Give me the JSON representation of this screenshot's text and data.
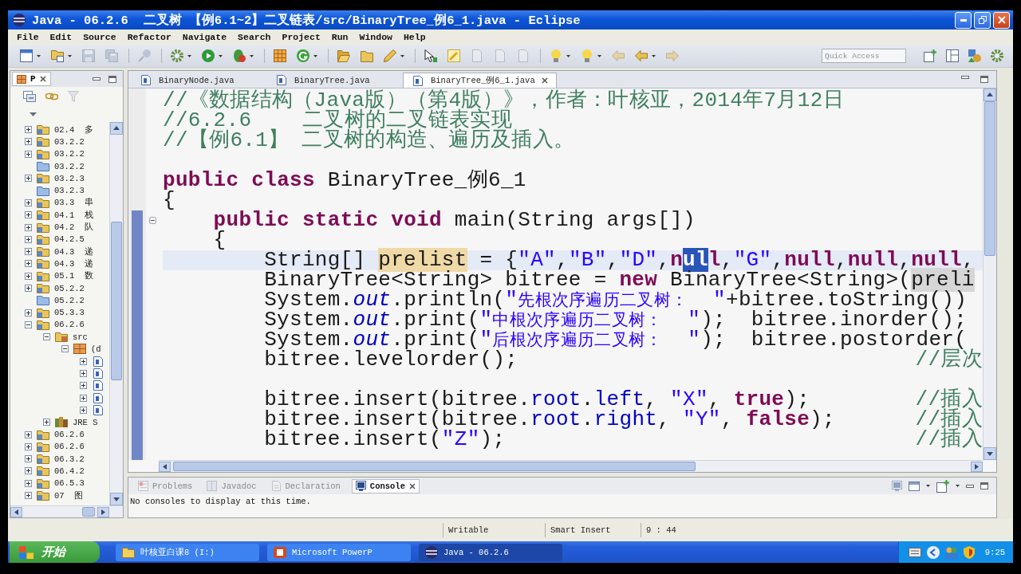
{
  "window": {
    "title": "Java - 06.2.6  二叉树 【例6.1~2】二叉链表/src/BinaryTree_例6_1.java - Eclipse"
  },
  "menu": [
    "File",
    "Edit",
    "Source",
    "Refactor",
    "Navigate",
    "Search",
    "Project",
    "Run",
    "Window",
    "Help"
  ],
  "toolbar": {
    "quick_access": {
      "placeholder": "Quick Access"
    }
  },
  "package_explorer": {
    "tab_label": "P",
    "tree": [
      {
        "label": "02.4  多",
        "kind": "project",
        "expanded": false
      },
      {
        "label": "03.2.2",
        "kind": "project",
        "expanded": false
      },
      {
        "label": "03.2.2",
        "kind": "project",
        "expanded": false
      },
      {
        "label": "03.2.2",
        "kind": "closed-project"
      },
      {
        "label": "03.2.3",
        "kind": "project",
        "expanded": false
      },
      {
        "label": "03.2.3",
        "kind": "closed-project"
      },
      {
        "label": "03.3  串",
        "kind": "project",
        "expanded": false
      },
      {
        "label": "04.1  栈",
        "kind": "project",
        "expanded": false
      },
      {
        "label": "04.2  队",
        "kind": "project",
        "expanded": false
      },
      {
        "label": "04.2.5",
        "kind": "project",
        "expanded": false
      },
      {
        "label": "04.3  递",
        "kind": "project",
        "expanded": false
      },
      {
        "label": "04.3  递",
        "kind": "project",
        "expanded": false
      },
      {
        "label": "05.1  数",
        "kind": "project",
        "expanded": false
      },
      {
        "label": "05.2.2",
        "kind": "project",
        "expanded": false
      },
      {
        "label": "05.2.2",
        "kind": "closed-project"
      },
      {
        "label": "05.3.3",
        "kind": "project",
        "expanded": false
      },
      {
        "label": "06.2.6",
        "kind": "project",
        "expanded": true,
        "children": [
          {
            "label": "src",
            "kind": "source-folder",
            "expanded": true,
            "children": [
              {
                "label": "(d",
                "kind": "package",
                "expanded": true,
                "children": [
                  {
                    "kind": "java-file",
                    "expanded": false
                  },
                  {
                    "kind": "java-file",
                    "expanded": false
                  },
                  {
                    "kind": "java-file",
                    "expanded": false
                  },
                  {
                    "kind": "java-file",
                    "expanded": false
                  },
                  {
                    "kind": "java-file",
                    "expanded": false
                  }
                ]
              }
            ]
          },
          {
            "label": "JRE S",
            "kind": "library",
            "expanded": false
          }
        ]
      },
      {
        "label": "06.2.6",
        "kind": "project",
        "expanded": false
      },
      {
        "label": "06.2.6",
        "kind": "project",
        "expanded": false
      },
      {
        "label": "06.3.2",
        "kind": "project",
        "expanded": false
      },
      {
        "label": "06.4.2",
        "kind": "project",
        "expanded": false
      },
      {
        "label": "06.5.3",
        "kind": "project",
        "expanded": false
      },
      {
        "label": "07  图",
        "kind": "project",
        "expanded": false
      }
    ]
  },
  "editor": {
    "tabs": [
      {
        "label": "BinaryNode.java",
        "selected": false
      },
      {
        "label": "BinaryTree.java",
        "selected": false
      },
      {
        "label": "BinaryTree_例6_1.java",
        "selected": true
      }
    ],
    "lines": [
      {
        "kind": "code",
        "current": false,
        "tokens": [
          {
            "text": "//《数据结构（Java版）（第4版）》，作者：叶核亚，2014年7月12日",
            "kind": "comment"
          }
        ]
      },
      {
        "kind": "code",
        "current": false,
        "tokens": [
          {
            "text": "//6.2.6    二叉树的二叉链表实现",
            "kind": "comment"
          }
        ]
      },
      {
        "kind": "code",
        "current": false,
        "tokens": [
          {
            "text": "//【例6.1】 二叉树的构造、遍历及插入。",
            "kind": "comment"
          }
        ]
      },
      {
        "kind": "blank",
        "current": false
      },
      {
        "kind": "code",
        "current": false,
        "tokens": [
          {
            "text": "public ",
            "kind": "keyword"
          },
          {
            "text": "class",
            "kind": "keyword"
          },
          {
            "text": " BinaryTree_例6_1",
            "kind": "plain"
          }
        ]
      },
      {
        "kind": "code",
        "current": false,
        "tokens": [
          {
            "text": "{",
            "kind": "plain"
          }
        ],
        "children": [
          {
            "kind": "code",
            "current": false,
            "tokens": [
              {
                "text": "public ",
                "kind": "keyword"
              },
              {
                "text": "static ",
                "kind": "keyword"
              },
              {
                "text": "void",
                "kind": "keyword"
              },
              {
                "text": " main(String args[])",
                "kind": "plain"
              }
            ]
          },
          {
            "kind": "code",
            "current": false,
            "tokens": [
              {
                "text": "{",
                "kind": "plain"
              }
            ],
            "children": [
              {
                "kind": "code",
                "current": true,
                "tokens": [
                  {
                    "text": "String[] ",
                    "kind": "plain"
                  },
                  {
                    "text": "prelist",
                    "kind": "occurrence"
                  },
                  {
                    "text": " = {",
                    "kind": "plain"
                  },
                  {
                    "text": "\"A\"",
                    "kind": "string"
                  },
                  {
                    "text": ",",
                    "kind": "plain"
                  },
                  {
                    "text": "\"B\"",
                    "kind": "string"
                  },
                  {
                    "text": ",",
                    "kind": "plain"
                  },
                  {
                    "text": "\"D\"",
                    "kind": "string"
                  },
                  {
                    "text": ",",
                    "kind": "plain"
                  },
                  {
                    "text": "n",
                    "kind": "keyword"
                  },
                  {
                    "text": "ul",
                    "kind": "selected"
                  },
                  {
                    "text": "l",
                    "kind": "keyword"
                  },
                  {
                    "text": ",",
                    "kind": "plain"
                  },
                  {
                    "text": "\"G\"",
                    "kind": "string"
                  },
                  {
                    "text": ",",
                    "kind": "plain"
                  },
                  {
                    "text": "null",
                    "kind": "keyword"
                  },
                  {
                    "text": ",",
                    "kind": "plain"
                  },
                  {
                    "text": "null",
                    "kind": "keyword"
                  },
                  {
                    "text": ",",
                    "kind": "plain"
                  },
                  {
                    "text": "null",
                    "kind": "keyword"
                  },
                  {
                    "text": ",",
                    "kind": "plain"
                  }
                ]
              },
              {
                "kind": "code",
                "current": false,
                "tokens": [
                  {
                    "text": "BinaryTree<String> bitree = ",
                    "kind": "plain"
                  },
                  {
                    "text": "new",
                    "kind": "keyword"
                  },
                  {
                    "text": " BinaryTree<String>(",
                    "kind": "plain"
                  },
                  {
                    "text": "preli",
                    "kind": "shaded"
                  }
                ]
              },
              {
                "kind": "code",
                "current": false,
                "tokens": [
                  {
                    "text": "System.",
                    "kind": "plain"
                  },
                  {
                    "text": "out",
                    "kind": "static-field"
                  },
                  {
                    "text": ".println(",
                    "kind": "plain"
                  },
                  {
                    "text": "\"",
                    "kind": "string"
                  },
                  {
                    "text": "先根次序遍历二叉树：",
                    "kind": "cjk-string"
                  },
                  {
                    "text": "  \"",
                    "kind": "string"
                  },
                  {
                    "text": "+bitree.toString())",
                    "kind": "plain"
                  }
                ]
              },
              {
                "kind": "code",
                "current": false,
                "tokens": [
                  {
                    "text": "System.",
                    "kind": "plain"
                  },
                  {
                    "text": "out",
                    "kind": "static-field"
                  },
                  {
                    "text": ".print(",
                    "kind": "plain"
                  },
                  {
                    "text": "\"",
                    "kind": "string"
                  },
                  {
                    "text": "中根次序遍历二叉树：",
                    "kind": "cjk-string"
                  },
                  {
                    "text": "  \"",
                    "kind": "string"
                  },
                  {
                    "text": ");  bitree.inorder();",
                    "kind": "plain"
                  }
                ]
              },
              {
                "kind": "code",
                "current": false,
                "tokens": [
                  {
                    "text": "System.",
                    "kind": "plain"
                  },
                  {
                    "text": "out",
                    "kind": "static-field"
                  },
                  {
                    "text": ".print(",
                    "kind": "plain"
                  },
                  {
                    "text": "\"",
                    "kind": "string"
                  },
                  {
                    "text": "后根次序遍历二叉树：",
                    "kind": "cjk-string"
                  },
                  {
                    "text": "  \"",
                    "kind": "string"
                  },
                  {
                    "text": ");  bitree.postorder(",
                    "kind": "plain"
                  }
                ]
              },
              {
                "kind": "code",
                "current": false,
                "tokens": [
                  {
                    "text": "bitree.levelorder();",
                    "kind": "plain"
                  }
                ],
                "comment": "//层次"
              },
              {
                "kind": "blank",
                "current": false
              },
              {
                "kind": "code",
                "current": false,
                "tokens": [
                  {
                    "text": "bitree.insert(bitree.",
                    "kind": "plain"
                  },
                  {
                    "text": "root",
                    "kind": "field"
                  },
                  {
                    "text": ".",
                    "kind": "plain"
                  },
                  {
                    "text": "left",
                    "kind": "field"
                  },
                  {
                    "text": ", ",
                    "kind": "plain"
                  },
                  {
                    "text": "\"X\"",
                    "kind": "string"
                  },
                  {
                    "text": ", ",
                    "kind": "plain"
                  },
                  {
                    "text": "true",
                    "kind": "keyword"
                  },
                  {
                    "text": ");",
                    "kind": "plain"
                  }
                ],
                "comment": "//插入"
              },
              {
                "kind": "code",
                "current": false,
                "tokens": [
                  {
                    "text": "bitree.insert(bitree.",
                    "kind": "plain"
                  },
                  {
                    "text": "root",
                    "kind": "field"
                  },
                  {
                    "text": ".",
                    "kind": "plain"
                  },
                  {
                    "text": "right",
                    "kind": "field"
                  },
                  {
                    "text": ", ",
                    "kind": "plain"
                  },
                  {
                    "text": "\"Y\"",
                    "kind": "string"
                  },
                  {
                    "text": ", ",
                    "kind": "plain"
                  },
                  {
                    "text": "false",
                    "kind": "keyword"
                  },
                  {
                    "text": ");",
                    "kind": "plain"
                  }
                ],
                "comment": "//插入"
              },
              {
                "kind": "code",
                "current": false,
                "tokens": [
                  {
                    "text": "bitree.insert(",
                    "kind": "plain"
                  },
                  {
                    "text": "\"Z\"",
                    "kind": "string"
                  },
                  {
                    "text": ");",
                    "kind": "plain"
                  }
                ],
                "comment": "//插入"
              }
            ]
          }
        ]
      }
    ]
  },
  "bottom_panel": {
    "tabs": [
      {
        "label": "Problems",
        "kind": "problems",
        "selected": false
      },
      {
        "label": "Javadoc",
        "kind": "javadoc",
        "selected": false
      },
      {
        "label": "Declaration",
        "kind": "declaration",
        "selected": false
      },
      {
        "label": "Console",
        "kind": "console",
        "selected": true
      }
    ],
    "message": "No consoles to display at this time."
  },
  "status_bar": {
    "write_mode": "Writable",
    "insert_mode": "Smart Insert",
    "cursor_position": "9 : 44"
  },
  "taskbar": {
    "start_label": "开始",
    "tasks": [
      {
        "label": "叶核亚白课8 (I:)",
        "kind": "folder",
        "selected": false
      },
      {
        "label": "Microsoft PowerP",
        "kind": "presentation",
        "selected": false
      },
      {
        "label": "Java - 06.2.6",
        "kind": "eclipse",
        "selected": true
      }
    ],
    "clock": "9:25"
  }
}
